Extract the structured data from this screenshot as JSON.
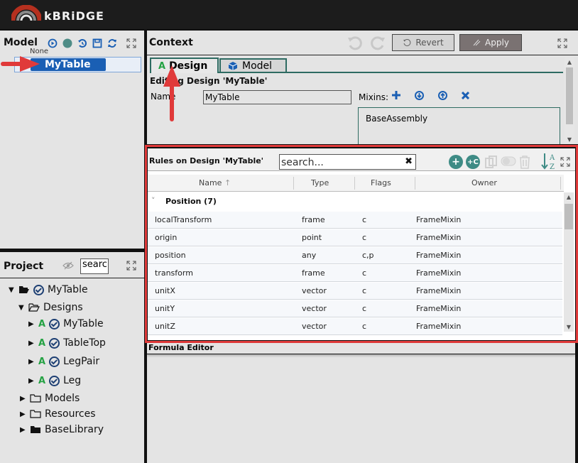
{
  "app": {
    "name": "kBRiDGE"
  },
  "model_panel": {
    "title": "Model",
    "tools": [
      "play-icon",
      "status-dot-icon",
      "undo-history-icon",
      "save-icon",
      "refresh-icon",
      "expand-icon"
    ],
    "selected_item": "MyTable",
    "hidden_row_text": "None"
  },
  "project_panel": {
    "title": "Project",
    "search_value": "search",
    "tree": [
      {
        "label": "MyTable",
        "kind": "project",
        "expanded": true
      },
      {
        "label": "Designs",
        "kind": "folder",
        "expanded": true
      },
      {
        "label": "MyTable",
        "kind": "design",
        "expanded": false
      },
      {
        "label": "TableTop",
        "kind": "design",
        "expanded": false
      },
      {
        "label": "LegPair",
        "kind": "design",
        "expanded": false
      },
      {
        "label": "Leg",
        "kind": "design",
        "expanded": false
      },
      {
        "label": "Models",
        "kind": "folder",
        "expanded": false
      },
      {
        "label": "Resources",
        "kind": "folder",
        "expanded": false
      },
      {
        "label": "BaseLibrary",
        "kind": "library",
        "expanded": false
      }
    ]
  },
  "context_panel": {
    "title": "Context",
    "revert_label": "Revert",
    "apply_label": "Apply",
    "tabs": [
      {
        "label": "Design",
        "active": true
      },
      {
        "label": "Model",
        "active": false
      }
    ],
    "editing_label": "Editing Design 'MyTable'",
    "name_label": "Name",
    "name_value": "MyTable",
    "mixins_label": "Mixins:",
    "mixins": [
      "BaseAssembly"
    ]
  },
  "rules_panel": {
    "title": "Rules on Design 'MyTable'",
    "search_placeholder": "search...",
    "columns": [
      "Name",
      "Type",
      "Flags",
      "Owner"
    ],
    "sort_indicator": "↑",
    "group": {
      "label": "Position (7)",
      "expanded": true
    },
    "rows": [
      {
        "name": "localTransform",
        "type": "frame",
        "flags": "c",
        "owner": "FrameMixin"
      },
      {
        "name": "origin",
        "type": "point",
        "flags": "c",
        "owner": "FrameMixin"
      },
      {
        "name": "position",
        "type": "any",
        "flags": "c,p",
        "owner": "FrameMixin"
      },
      {
        "name": "transform",
        "type": "frame",
        "flags": "c",
        "owner": "FrameMixin"
      },
      {
        "name": "unitX",
        "type": "vector",
        "flags": "c",
        "owner": "FrameMixin"
      },
      {
        "name": "unitY",
        "type": "vector",
        "flags": "c",
        "owner": "FrameMixin"
      },
      {
        "name": "unitZ",
        "type": "vector",
        "flags": "c",
        "owner": "FrameMixin"
      }
    ]
  },
  "formula_panel": {
    "title": "Formula Editor"
  },
  "colors": {
    "accent_blue": "#1a5fb4",
    "teal": "#3e8b85",
    "design_green": "#25a244",
    "highlight_red": "#e03a3a"
  }
}
